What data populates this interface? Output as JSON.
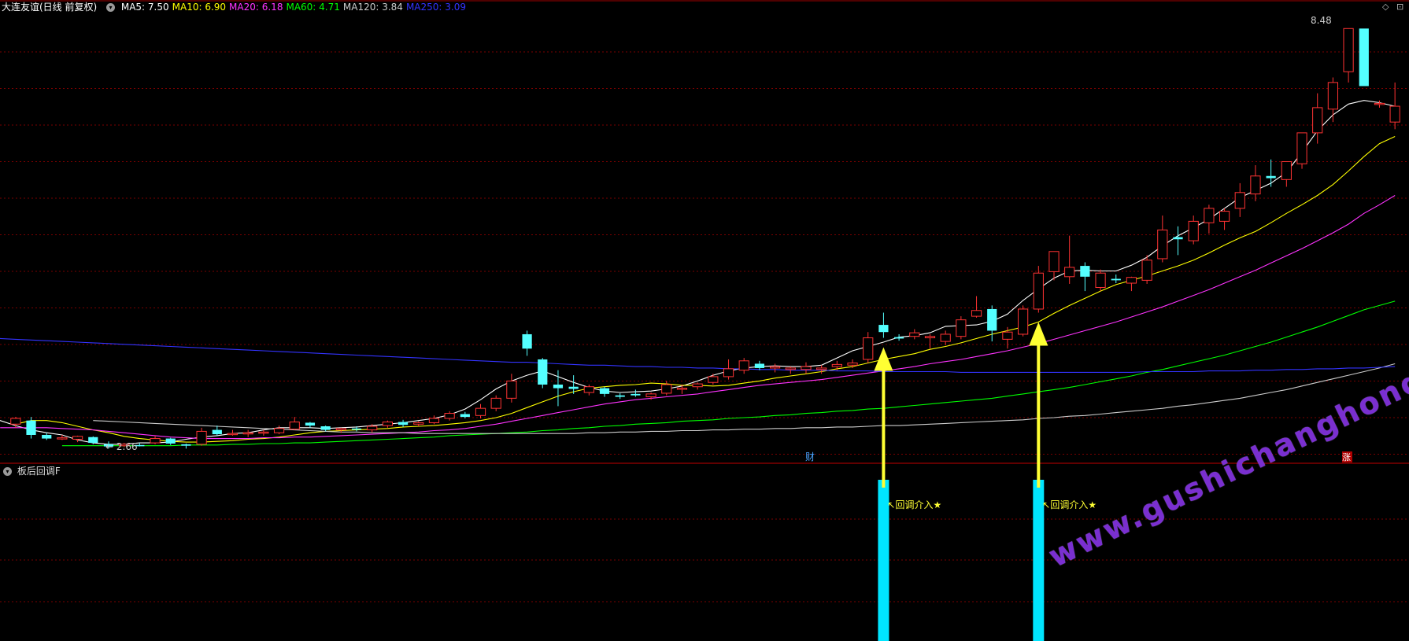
{
  "header": {
    "title": "大连友谊(日线 前复权)",
    "ma_items": [
      {
        "label": "MA5: 7.50",
        "color": "#ffffff"
      },
      {
        "label": "MA10: 6.90",
        "color": "#ffff00"
      },
      {
        "label": "MA20: 6.18",
        "color": "#ff33ff"
      },
      {
        "label": "MA60: 4.71",
        "color": "#00ff00"
      },
      {
        "label": "MA120: 3.84",
        "color": "#cccccc"
      },
      {
        "label": "MA250: 3.09",
        "color": "#3333ff"
      }
    ]
  },
  "indicator": {
    "title": "板后回调F",
    "signal_label": "回调介入★"
  },
  "labels": {
    "high_price": "8.48",
    "low_price": "2.66",
    "finance_marker": "财",
    "rise_marker": "涨",
    "corner_icons": [
      "◇",
      "⊡"
    ]
  },
  "watermark": "www.gushichanghong.com",
  "colors": {
    "up": "#ff3333",
    "down": "#54ffff",
    "grid": "#7a0000",
    "arrow": "#ffff33",
    "signal_bar": "#00e5ff"
  },
  "chart_data": {
    "type": "candlestick",
    "price_range": [
      2.5,
      8.7
    ],
    "candles": [
      [
        3.0,
        3.1,
        2.95,
        3.08
      ],
      [
        3.05,
        3.1,
        2.8,
        2.85
      ],
      [
        2.85,
        2.88,
        2.78,
        2.8
      ],
      [
        2.8,
        2.85,
        2.78,
        2.81
      ],
      [
        2.79,
        2.84,
        2.75,
        2.83
      ],
      [
        2.82,
        2.83,
        2.72,
        2.74
      ],
      [
        2.72,
        2.76,
        2.66,
        2.69
      ],
      [
        2.7,
        2.74,
        2.68,
        2.72
      ],
      [
        2.71,
        2.74,
        2.69,
        2.7
      ],
      [
        2.74,
        2.84,
        2.72,
        2.8
      ],
      [
        2.8,
        2.81,
        2.71,
        2.73
      ],
      [
        2.72,
        2.73,
        2.66,
        2.7
      ],
      [
        2.72,
        2.95,
        2.7,
        2.9
      ],
      [
        2.92,
        2.98,
        2.84,
        2.86
      ],
      [
        2.86,
        2.92,
        2.84,
        2.87
      ],
      [
        2.87,
        2.92,
        2.82,
        2.88
      ],
      [
        2.89,
        2.92,
        2.84,
        2.89
      ],
      [
        2.88,
        2.98,
        2.86,
        2.94
      ],
      [
        2.93,
        3.1,
        2.92,
        3.03
      ],
      [
        3.02,
        3.03,
        2.95,
        2.98
      ],
      [
        2.97,
        2.98,
        2.9,
        2.92
      ],
      [
        2.92,
        2.95,
        2.88,
        2.94
      ],
      [
        2.94,
        2.97,
        2.9,
        2.93
      ],
      [
        2.92,
        3.0,
        2.88,
        2.97
      ],
      [
        2.98,
        3.05,
        2.95,
        3.03
      ],
      [
        3.03,
        3.06,
        2.96,
        2.99
      ],
      [
        3.0,
        3.04,
        2.97,
        3.02
      ],
      [
        3.02,
        3.12,
        3.0,
        3.08
      ],
      [
        3.08,
        3.18,
        3.05,
        3.15
      ],
      [
        3.14,
        3.17,
        3.08,
        3.1
      ],
      [
        3.12,
        3.28,
        3.08,
        3.22
      ],
      [
        3.22,
        3.4,
        3.18,
        3.36
      ],
      [
        3.36,
        3.7,
        3.3,
        3.6
      ],
      [
        4.25,
        4.3,
        3.95,
        4.05
      ],
      [
        3.9,
        3.92,
        3.5,
        3.55
      ],
      [
        3.55,
        3.75,
        3.25,
        3.5
      ],
      [
        3.52,
        3.68,
        3.42,
        3.49
      ],
      [
        3.44,
        3.55,
        3.4,
        3.52
      ],
      [
        3.5,
        3.52,
        3.38,
        3.42
      ],
      [
        3.4,
        3.43,
        3.35,
        3.38
      ],
      [
        3.42,
        3.48,
        3.38,
        3.4
      ],
      [
        3.38,
        3.44,
        3.34,
        3.42
      ],
      [
        3.43,
        3.6,
        3.4,
        3.55
      ],
      [
        3.5,
        3.55,
        3.42,
        3.5
      ],
      [
        3.52,
        3.58,
        3.48,
        3.56
      ],
      [
        3.58,
        3.7,
        3.55,
        3.66
      ],
      [
        3.66,
        3.9,
        3.62,
        3.77
      ],
      [
        3.75,
        3.92,
        3.7,
        3.88
      ],
      [
        3.84,
        3.88,
        3.75,
        3.78
      ],
      [
        3.78,
        3.84,
        3.72,
        3.8
      ],
      [
        3.76,
        3.8,
        3.7,
        3.78
      ],
      [
        3.76,
        3.86,
        3.7,
        3.8
      ],
      [
        3.76,
        3.82,
        3.7,
        3.78
      ],
      [
        3.8,
        3.88,
        3.75,
        3.83
      ],
      [
        3.82,
        3.9,
        3.78,
        3.85
      ],
      [
        3.9,
        4.28,
        3.85,
        4.2
      ],
      [
        4.38,
        4.55,
        4.2,
        4.28
      ],
      [
        4.21,
        4.25,
        4.16,
        4.19
      ],
      [
        4.22,
        4.32,
        4.18,
        4.27
      ],
      [
        4.2,
        4.25,
        4.05,
        4.22
      ],
      [
        4.15,
        4.3,
        4.1,
        4.25
      ],
      [
        4.22,
        4.5,
        4.18,
        4.45
      ],
      [
        4.5,
        4.78,
        4.48,
        4.58
      ],
      [
        4.6,
        4.65,
        4.15,
        4.3
      ],
      [
        4.18,
        4.35,
        4.05,
        4.28
      ],
      [
        4.25,
        4.65,
        4.22,
        4.6
      ],
      [
        4.6,
        5.2,
        4.55,
        5.1
      ],
      [
        5.12,
        5.4,
        5.0,
        5.4
      ],
      [
        5.05,
        5.62,
        4.95,
        5.18
      ],
      [
        5.2,
        5.25,
        4.85,
        5.05
      ],
      [
        4.9,
        5.15,
        4.85,
        5.1
      ],
      [
        5.02,
        5.08,
        4.96,
        5.0
      ],
      [
        4.96,
        5.05,
        4.85,
        5.04
      ],
      [
        5.0,
        5.35,
        4.95,
        5.28
      ],
      [
        5.3,
        5.9,
        5.25,
        5.7
      ],
      [
        5.6,
        5.75,
        5.35,
        5.57
      ],
      [
        5.55,
        5.9,
        5.5,
        5.82
      ],
      [
        5.8,
        6.05,
        5.65,
        6.0
      ],
      [
        5.82,
        6.0,
        5.7,
        5.96
      ],
      [
        6.0,
        6.35,
        5.88,
        6.22
      ],
      [
        6.2,
        6.6,
        6.1,
        6.45
      ],
      [
        6.45,
        6.68,
        6.3,
        6.42
      ],
      [
        6.4,
        6.65,
        6.3,
        6.65
      ],
      [
        6.62,
        7.0,
        6.55,
        7.05
      ],
      [
        7.05,
        7.6,
        6.9,
        7.4
      ],
      [
        7.38,
        7.82,
        7.2,
        7.75
      ],
      [
        7.9,
        8.4,
        7.75,
        8.5
      ],
      [
        8.5,
        8.4,
        8.02,
        7.7
      ],
      [
        7.45,
        7.5,
        7.4,
        7.46
      ],
      [
        7.2,
        7.75,
        7.1,
        7.42
      ]
    ],
    "ma_lines": {
      "MA5": [
        3.1,
        3.05,
        2.98,
        2.92,
        2.88,
        2.85,
        2.78,
        2.74,
        2.72,
        2.72,
        2.74,
        2.74,
        2.75,
        2.79,
        2.82,
        2.84,
        2.87,
        2.88,
        2.92,
        2.95,
        2.95,
        2.95,
        2.94,
        2.95,
        2.96,
        2.98,
        3.0,
        3.02,
        3.05,
        3.08,
        3.13,
        3.21,
        3.34,
        3.49,
        3.6,
        3.68,
        3.74,
        3.66,
        3.58,
        3.51,
        3.46,
        3.44,
        3.45,
        3.46,
        3.49,
        3.53,
        3.6,
        3.68,
        3.74,
        3.78,
        3.8,
        3.81,
        3.8,
        3.8,
        3.82,
        3.92,
        4.02,
        4.08,
        4.14,
        4.21,
        4.23,
        4.27,
        4.36,
        4.37,
        4.38,
        4.43,
        4.53,
        4.72,
        4.88,
        5.03,
        5.13,
        5.14,
        5.13,
        5.13,
        5.21,
        5.32,
        5.48,
        5.62,
        5.73,
        5.85,
        6.0,
        6.15,
        6.25,
        6.35,
        6.5,
        6.78,
        7.08,
        7.3,
        7.45,
        7.5,
        7.47,
        7.42
      ],
      "MA10": [
        3.0,
        3.05,
        3.05,
        3.02,
        2.97,
        2.92,
        2.88,
        2.83,
        2.8,
        2.78,
        2.76,
        2.75,
        2.75,
        2.76,
        2.77,
        2.79,
        2.8,
        2.82,
        2.85,
        2.88,
        2.9,
        2.91,
        2.92,
        2.93,
        2.94,
        2.96,
        2.97,
        2.98,
        3.0,
        3.02,
        3.05,
        3.09,
        3.15,
        3.23,
        3.31,
        3.39,
        3.45,
        3.5,
        3.52,
        3.54,
        3.55,
        3.57,
        3.56,
        3.54,
        3.54,
        3.53,
        3.54,
        3.57,
        3.6,
        3.64,
        3.67,
        3.7,
        3.73,
        3.77,
        3.8,
        3.85,
        3.9,
        3.94,
        3.98,
        4.04,
        4.08,
        4.13,
        4.19,
        4.25,
        4.3,
        4.35,
        4.42,
        4.54,
        4.65,
        4.75,
        4.85,
        4.94,
        5.0,
        5.06,
        5.13,
        5.2,
        5.28,
        5.38,
        5.49,
        5.59,
        5.68,
        5.8,
        5.93,
        6.05,
        6.18,
        6.33,
        6.52,
        6.72,
        6.9,
        7.0
      ],
      "MA20": [
        2.95,
        2.95,
        2.95,
        2.95,
        2.94,
        2.93,
        2.92,
        2.9,
        2.88,
        2.86,
        2.84,
        2.82,
        2.81,
        2.8,
        2.8,
        2.8,
        2.8,
        2.81,
        2.81,
        2.82,
        2.82,
        2.83,
        2.84,
        2.85,
        2.86,
        2.87,
        2.88,
        2.89,
        2.91,
        2.92,
        2.94,
        2.97,
        3.0,
        3.04,
        3.08,
        3.12,
        3.16,
        3.2,
        3.24,
        3.28,
        3.31,
        3.34,
        3.36,
        3.38,
        3.4,
        3.42,
        3.45,
        3.48,
        3.51,
        3.54,
        3.56,
        3.58,
        3.6,
        3.62,
        3.65,
        3.68,
        3.71,
        3.74,
        3.77,
        3.8,
        3.84,
        3.87,
        3.9,
        3.94,
        3.98,
        4.02,
        4.07,
        4.12,
        4.18,
        4.24,
        4.3,
        4.36,
        4.42,
        4.49,
        4.56,
        4.63,
        4.71,
        4.79,
        4.87,
        4.96,
        5.05,
        5.14,
        5.24,
        5.34,
        5.44,
        5.55,
        5.66,
        5.78,
        5.93,
        6.05,
        6.18
      ],
      "MA60": [
        2.7,
        2.7,
        2.7,
        2.7,
        2.7,
        2.7,
        2.7,
        2.7,
        2.71,
        2.71,
        2.71,
        2.72,
        2.72,
        2.73,
        2.73,
        2.74,
        2.74,
        2.75,
        2.76,
        2.77,
        2.78,
        2.79,
        2.8,
        2.81,
        2.82,
        2.84,
        2.85,
        2.86,
        2.87,
        2.88,
        2.89,
        2.91,
        2.92,
        2.94,
        2.95,
        2.97,
        2.98,
        3.0,
        3.01,
        3.02,
        3.04,
        3.05,
        3.06,
        3.08,
        3.09,
        3.1,
        3.12,
        3.13,
        3.15,
        3.16,
        3.18,
        3.19,
        3.21,
        3.22,
        3.24,
        3.26,
        3.28,
        3.3,
        3.32,
        3.34,
        3.36,
        3.39,
        3.42,
        3.45,
        3.48,
        3.51,
        3.55,
        3.59,
        3.63,
        3.67,
        3.72,
        3.76,
        3.81,
        3.86,
        3.91,
        3.96,
        4.02,
        4.08,
        4.14,
        4.21,
        4.28,
        4.35,
        4.43,
        4.51,
        4.59,
        4.65,
        4.71
      ],
      "MA120": [
        3.05,
        3.04,
        3.03,
        3.02,
        3.01,
        3.0,
        2.99,
        2.98,
        2.97,
        2.96,
        2.95,
        2.94,
        2.93,
        2.92,
        2.91,
        2.9,
        2.89,
        2.89,
        2.88,
        2.88,
        2.88,
        2.87,
        2.87,
        2.87,
        2.87,
        2.87,
        2.87,
        2.87,
        2.87,
        2.87,
        2.87,
        2.87,
        2.88,
        2.88,
        2.89,
        2.89,
        2.9,
        2.9,
        2.91,
        2.91,
        2.92,
        2.92,
        2.93,
        2.93,
        2.94,
        2.94,
        2.95,
        2.95,
        2.96,
        2.96,
        2.97,
        2.98,
        2.98,
        2.99,
        3.0,
        3.01,
        3.02,
        3.03,
        3.04,
        3.05,
        3.06,
        3.08,
        3.09,
        3.11,
        3.12,
        3.14,
        3.16,
        3.18,
        3.2,
        3.22,
        3.25,
        3.27,
        3.3,
        3.33,
        3.36,
        3.4,
        3.44,
        3.48,
        3.53,
        3.58,
        3.63,
        3.68,
        3.73,
        3.78,
        3.84
      ],
      "MA250": [
        4.2,
        4.19,
        4.18,
        4.17,
        4.16,
        4.15,
        4.14,
        4.13,
        4.12,
        4.11,
        4.1,
        4.09,
        4.08,
        4.07,
        4.06,
        4.05,
        4.04,
        4.03,
        4.02,
        4.01,
        4.0,
        3.99,
        3.98,
        3.97,
        3.96,
        3.95,
        3.94,
        3.93,
        3.92,
        3.91,
        3.9,
        3.89,
        3.88,
        3.87,
        3.86,
        3.86,
        3.85,
        3.84,
        3.83,
        3.82,
        3.82,
        3.81,
        3.8,
        3.8,
        3.79,
        3.79,
        3.78,
        3.78,
        3.77,
        3.77,
        3.76,
        3.76,
        3.75,
        3.75,
        3.75,
        3.74,
        3.74,
        3.74,
        3.73,
        3.73,
        3.73,
        3.73,
        3.73,
        3.72,
        3.72,
        3.72,
        3.72,
        3.72,
        3.72,
        3.72,
        3.72,
        3.72,
        3.72,
        3.72,
        3.72,
        3.73,
        3.73,
        3.73,
        3.73,
        3.74,
        3.74,
        3.74,
        3.75,
        3.75,
        3.76,
        3.76,
        3.77,
        3.77,
        3.78,
        3.78,
        3.79,
        3.8
      ]
    },
    "signal_indices": [
      56,
      66
    ]
  }
}
